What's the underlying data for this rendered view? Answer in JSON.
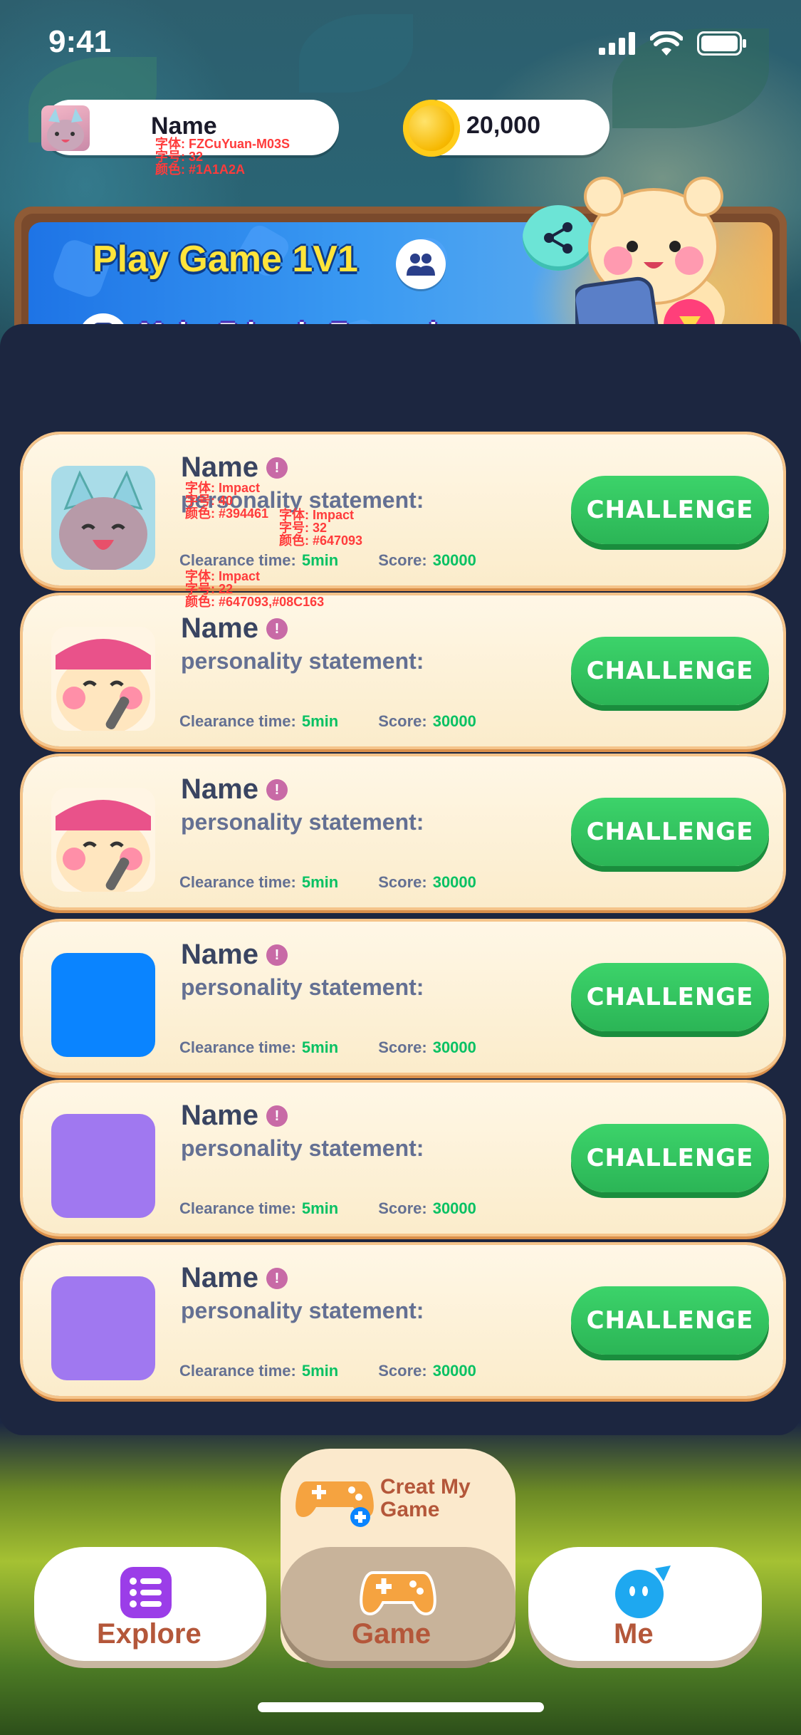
{
  "status_bar": {
    "time": "9:41"
  },
  "profile": {
    "name": "Name",
    "annotation_font": "字体: FZCuYuan-M03S",
    "annotation_size": "字号: 32",
    "annotation_color": "颜色: #1A1A2A"
  },
  "coins": {
    "value": "20,000"
  },
  "banner": {
    "title": "Play Game 1V1",
    "subtitle": "Make Friends Everywhere"
  },
  "list": {
    "annotations": {
      "name_font": "字体: Impact",
      "name_size": "字号: 40",
      "name_color": "颜色: #394461",
      "stmt_font": "字体: Impact",
      "stmt_size": "字号: 32",
      "stmt_color": "颜色: #647093",
      "meta_font": "字体: Impact",
      "meta_size": "字号: 22",
      "meta_color": "颜色: #647093,#08C163"
    },
    "items": [
      {
        "name": "Name",
        "statement": "personality statement:",
        "clearance_label": "Clearance time:",
        "clearance_value": "5min",
        "score_label": "Score:",
        "score_value": "30000",
        "button": "CHALLENGE",
        "avatar": "cat-hood"
      },
      {
        "name": "Name",
        "statement": "personality statement:",
        "clearance_label": "Clearance time:",
        "clearance_value": "5min",
        "score_label": "Score:",
        "score_value": "30000",
        "button": "CHALLENGE",
        "avatar": "cat-pink-hat"
      },
      {
        "name": "Name",
        "statement": "personality statement:",
        "clearance_label": "Clearance time:",
        "clearance_value": "5min",
        "score_label": "Score:",
        "score_value": "30000",
        "button": "CHALLENGE",
        "avatar": "cat-pink-hat"
      },
      {
        "name": "Name",
        "statement": "personality statement:",
        "clearance_label": "Clearance time:",
        "clearance_value": "5min",
        "score_label": "Score:",
        "score_value": "30000",
        "button": "CHALLENGE",
        "avatar": "placeholder",
        "avatar_color": "#0A84FF"
      },
      {
        "name": "Name",
        "statement": "personality statement:",
        "clearance_label": "Clearance time:",
        "clearance_value": "5min",
        "score_label": "Score:",
        "score_value": "30000",
        "button": "CHALLENGE",
        "avatar": "placeholder",
        "avatar_color": "#A078F0"
      },
      {
        "name": "Name",
        "statement": "personality statement:",
        "clearance_label": "Clearance time:",
        "clearance_value": "5min",
        "score_label": "Score:",
        "score_value": "30000",
        "button": "CHALLENGE",
        "avatar": "placeholder",
        "avatar_color": "#A078F0"
      }
    ]
  },
  "tabs": {
    "create_label_line1": "Creat My",
    "create_label_line2": "Game",
    "explore": "Explore",
    "game": "Game",
    "me": "Me"
  },
  "colors": {
    "name": "#394461",
    "statement": "#647093",
    "value_green": "#08C163",
    "challenge_green": "#2BB556"
  }
}
